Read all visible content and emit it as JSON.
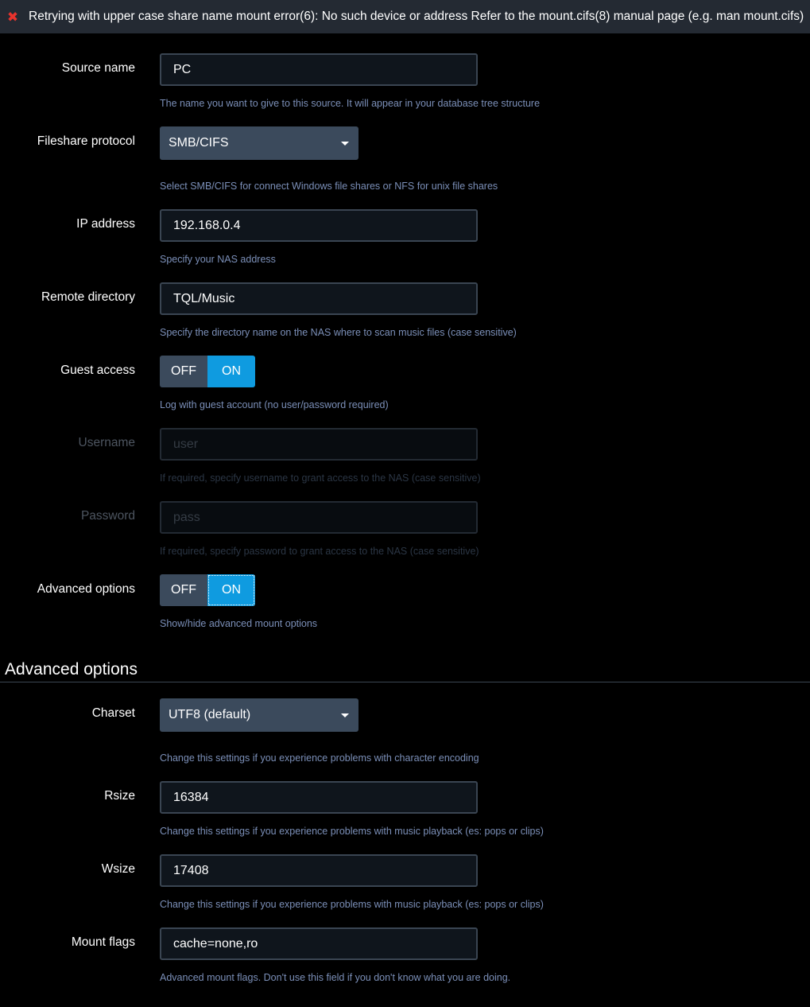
{
  "error": {
    "message": "Retrying with upper case share name mount error(6): No such device or address Refer to the mount.cifs(8) manual page (e.g. man mount.cifs)"
  },
  "fields": {
    "source_name": {
      "label": "Source name",
      "value": "PC",
      "help": "The name you want to give to this source. It will appear in your database tree structure"
    },
    "protocol": {
      "label": "Fileshare protocol",
      "value": "SMB/CIFS",
      "help": "Select SMB/CIFS for connect Windows file shares or NFS for unix file shares"
    },
    "ip_address": {
      "label": "IP address",
      "value": "192.168.0.4",
      "help": "Specify your NAS address"
    },
    "remote_directory": {
      "label": "Remote directory",
      "value": "TQL/Music",
      "help": "Specify the directory name on the NAS where to scan music files (case sensitive)"
    },
    "guest_access": {
      "label": "Guest access",
      "off_label": "OFF",
      "on_label": "ON",
      "state": "on",
      "help": "Log with guest account (no user/password required)"
    },
    "username": {
      "label": "Username",
      "placeholder": "user",
      "help": "If required, specify username to grant access to the NAS (case sensitive)"
    },
    "password": {
      "label": "Password",
      "placeholder": "pass",
      "help": "If required, specify password to grant access to the NAS (case sensitive)"
    },
    "advanced_toggle": {
      "label": "Advanced options",
      "off_label": "OFF",
      "on_label": "ON",
      "state": "on",
      "help": "Show/hide advanced mount options"
    }
  },
  "advanced": {
    "title": "Advanced options",
    "charset": {
      "label": "Charset",
      "value": "UTF8 (default)",
      "help": "Change this settings if you experience problems with character encoding"
    },
    "rsize": {
      "label": "Rsize",
      "value": "16384",
      "help": "Change this settings if you experience problems with music playback (es: pops or clips)"
    },
    "wsize": {
      "label": "Wsize",
      "value": "17408",
      "help": "Change this settings if you experience problems with music playback (es: pops or clips)"
    },
    "mount_flags": {
      "label": "Mount flags",
      "value": "cache=none,ro",
      "help": "Advanced mount flags. Don't use this field if you don't know what you are doing."
    }
  },
  "colors": {
    "background": "#000000",
    "error_bar": "#242a33",
    "error_icon": "#e8332d",
    "toggle_on": "#0f9be0",
    "select_bg": "#3b4a5c",
    "help_text": "#7b8fb8"
  },
  "icons": {
    "error": "close-x-icon",
    "select_caret": "caret-down-icon"
  }
}
